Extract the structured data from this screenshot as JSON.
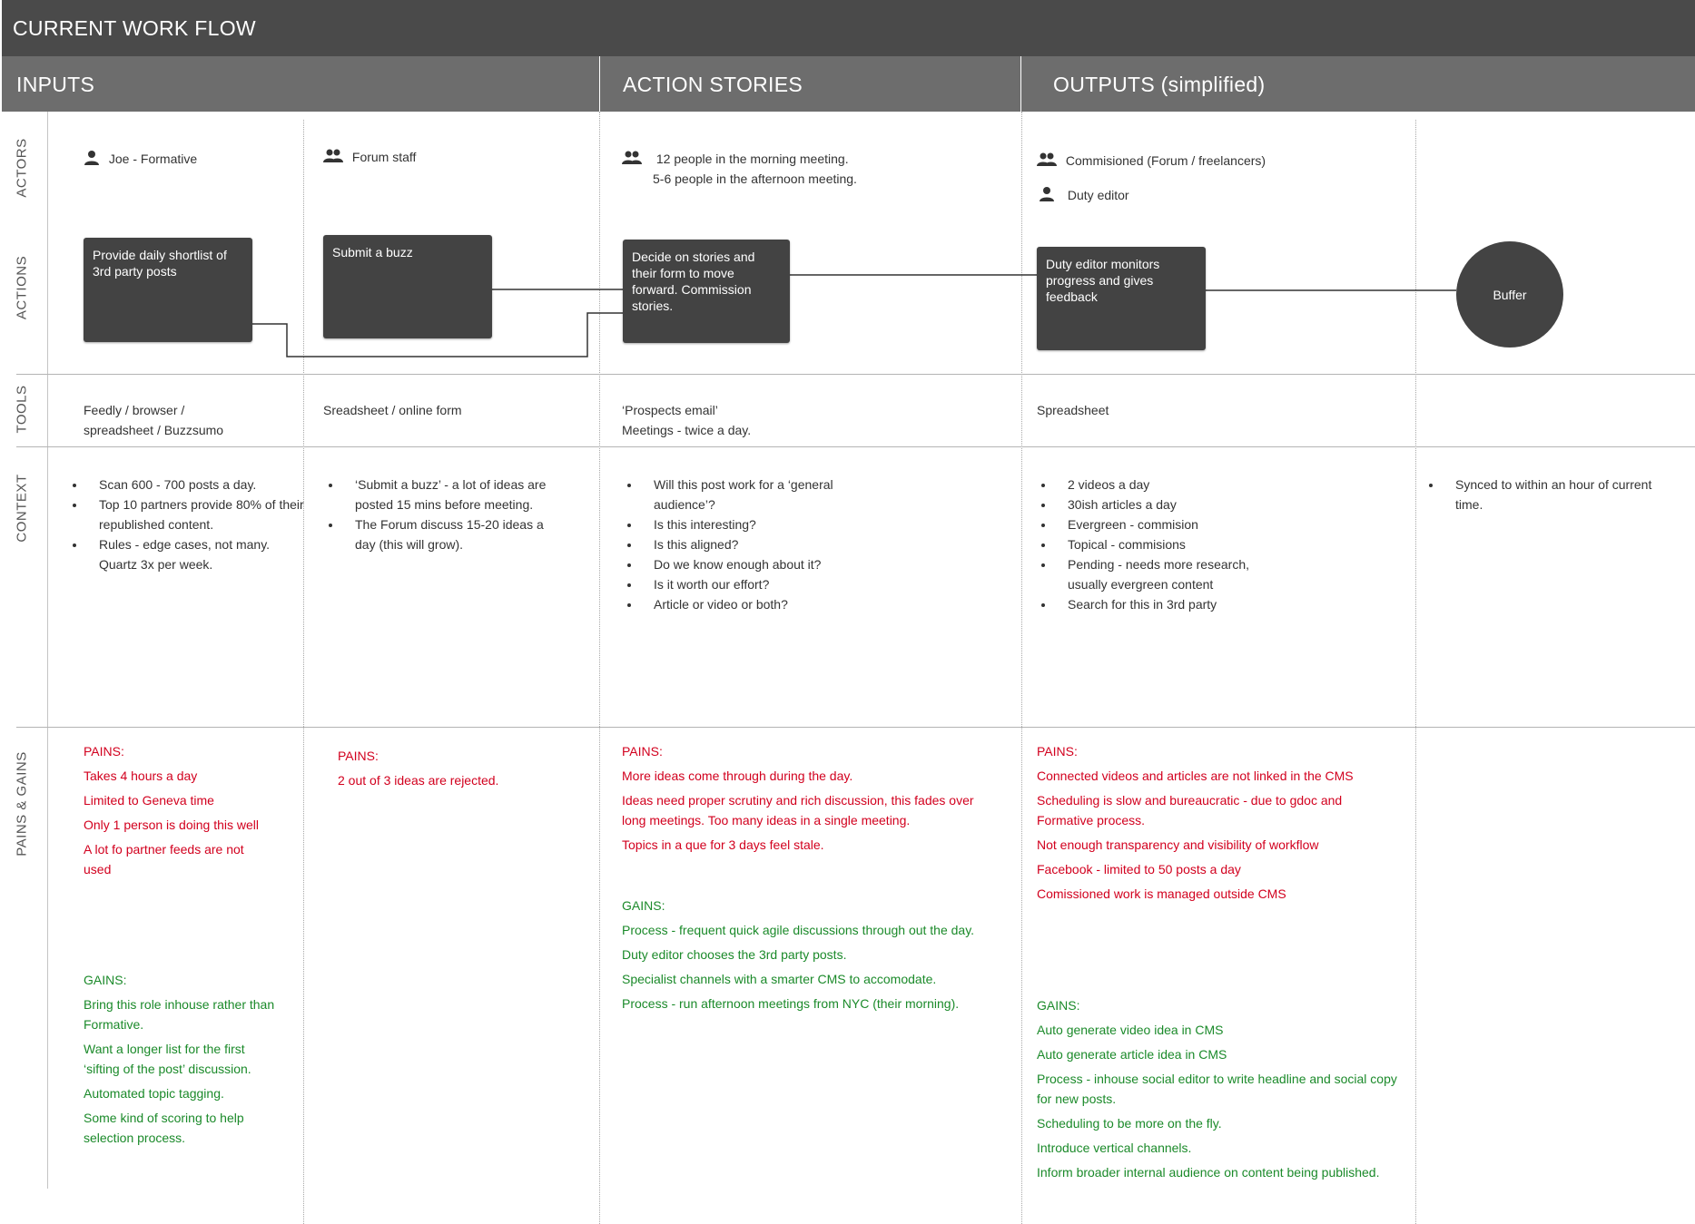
{
  "header": {
    "title": "CURRENT WORK FLOW"
  },
  "phases": [
    {
      "label": "INPUTS"
    },
    {
      "label": "ACTION STORIES"
    },
    {
      "label": "OUTPUTS (simplified)"
    }
  ],
  "row_labels": {
    "actors": "ACTORS",
    "actions": "ACTIONS",
    "tools": "TOOLS",
    "context": "CONTEXT",
    "pains_gains": "PAINS & GAINS"
  },
  "actors": {
    "col1": [
      "Joe - Formative"
    ],
    "col2": [
      "Forum staff"
    ],
    "col3": [
      "12 people in the morning meeting.",
      "5-6 people in the afternoon meeting."
    ],
    "col4": [
      "Commisioned (Forum / freelancers)",
      "Duty editor"
    ]
  },
  "actions": {
    "col1": "Provide daily shortlist of 3rd party posts",
    "col2": "Submit a buzz",
    "col3": "Decide on stories and their form to move forward. Commission stories.",
    "col4": "Duty editor monitors progress and gives feedback",
    "col5": "Buffer"
  },
  "tools": {
    "col1": [
      "Feedly / browser /",
      "spreadsheet / Buzzsumo"
    ],
    "col2": [
      "Sreadsheet / online form"
    ],
    "col3": [
      "‘Prospects email’",
      "Meetings - twice a day."
    ],
    "col4": [
      "Spreadsheet"
    ]
  },
  "context": {
    "col1": [
      "Scan 600 - 700 posts a day.",
      "Top 10 partners provide 80% of their republished content.",
      "Rules - edge cases, not many. Quartz 3x per week."
    ],
    "col2": [
      "‘Submit a buzz’ - a lot of ideas are posted 15 mins before meeting.",
      "The Forum discuss 15-20 ideas a day (this will grow)."
    ],
    "col3": [
      "Will this post work for a ‘general audience’?",
      "Is this interesting?",
      "Is this aligned?",
      "Do we know enough about it?",
      "Is it worth our effort?",
      "Article or video or both?"
    ],
    "col4": [
      "2 videos a day",
      "30ish articles a day",
      "Evergreen - commision",
      "Topical - commisions",
      "Pending - needs more research, usually evergreen content",
      "Search for this in 3rd party"
    ],
    "col5": [
      "Synced to within an hour of current time."
    ]
  },
  "pains_gains": {
    "pains_heading": "PAINS:",
    "gains_heading": "GAINS:",
    "col1": {
      "pains": [
        "Takes 4 hours a day",
        "Limited to Geneva time",
        "Only 1 person is doing this well",
        "A lot fo partner feeds are not used"
      ],
      "gains": [
        "Bring this role inhouse rather than Formative.",
        "Want a longer list for the first ‘sifting of the post’ discussion.",
        "Automated topic tagging.",
        "Some kind of scoring to help selection process."
      ]
    },
    "col2": {
      "pains": [
        "2 out of 3 ideas are rejected."
      ]
    },
    "col3": {
      "pains": [
        "More ideas come through during the day.",
        "Ideas need proper scrutiny and rich discussion, this fades over long meetings. Too many ideas in a single meeting.",
        "Topics in a que for 3 days feel stale."
      ],
      "gains": [
        "Process - frequent quick agile discussions through out the day.",
        "Duty editor chooses the 3rd party posts.",
        "Specialist channels with a smarter CMS to accomodate.",
        "Process - run afternoon meetings from NYC (their morning)."
      ]
    },
    "col4": {
      "pains": [
        "Connected videos and articles are not linked in the CMS",
        "Scheduling is slow and bureaucratic - due to gdoc and Formative process.",
        "Not enough transparency and visibility of workflow",
        "Facebook - limited to 50 posts a day",
        "Comissioned work is managed outside CMS"
      ],
      "gains": [
        "Auto generate video idea in CMS",
        "Auto generate article idea in CMS",
        "Process - inhouse social editor to write headline and social copy for new posts.",
        "Scheduling to be more on the fly.",
        "Introduce vertical channels.",
        "Inform broader internal audience on content being published."
      ]
    }
  },
  "colors": {
    "header_bg": "#4a4a4a",
    "phase_bg": "#6d6d6d",
    "box_bg": "#434343",
    "pain": "#d2001e",
    "gain": "#1b8a2a"
  }
}
